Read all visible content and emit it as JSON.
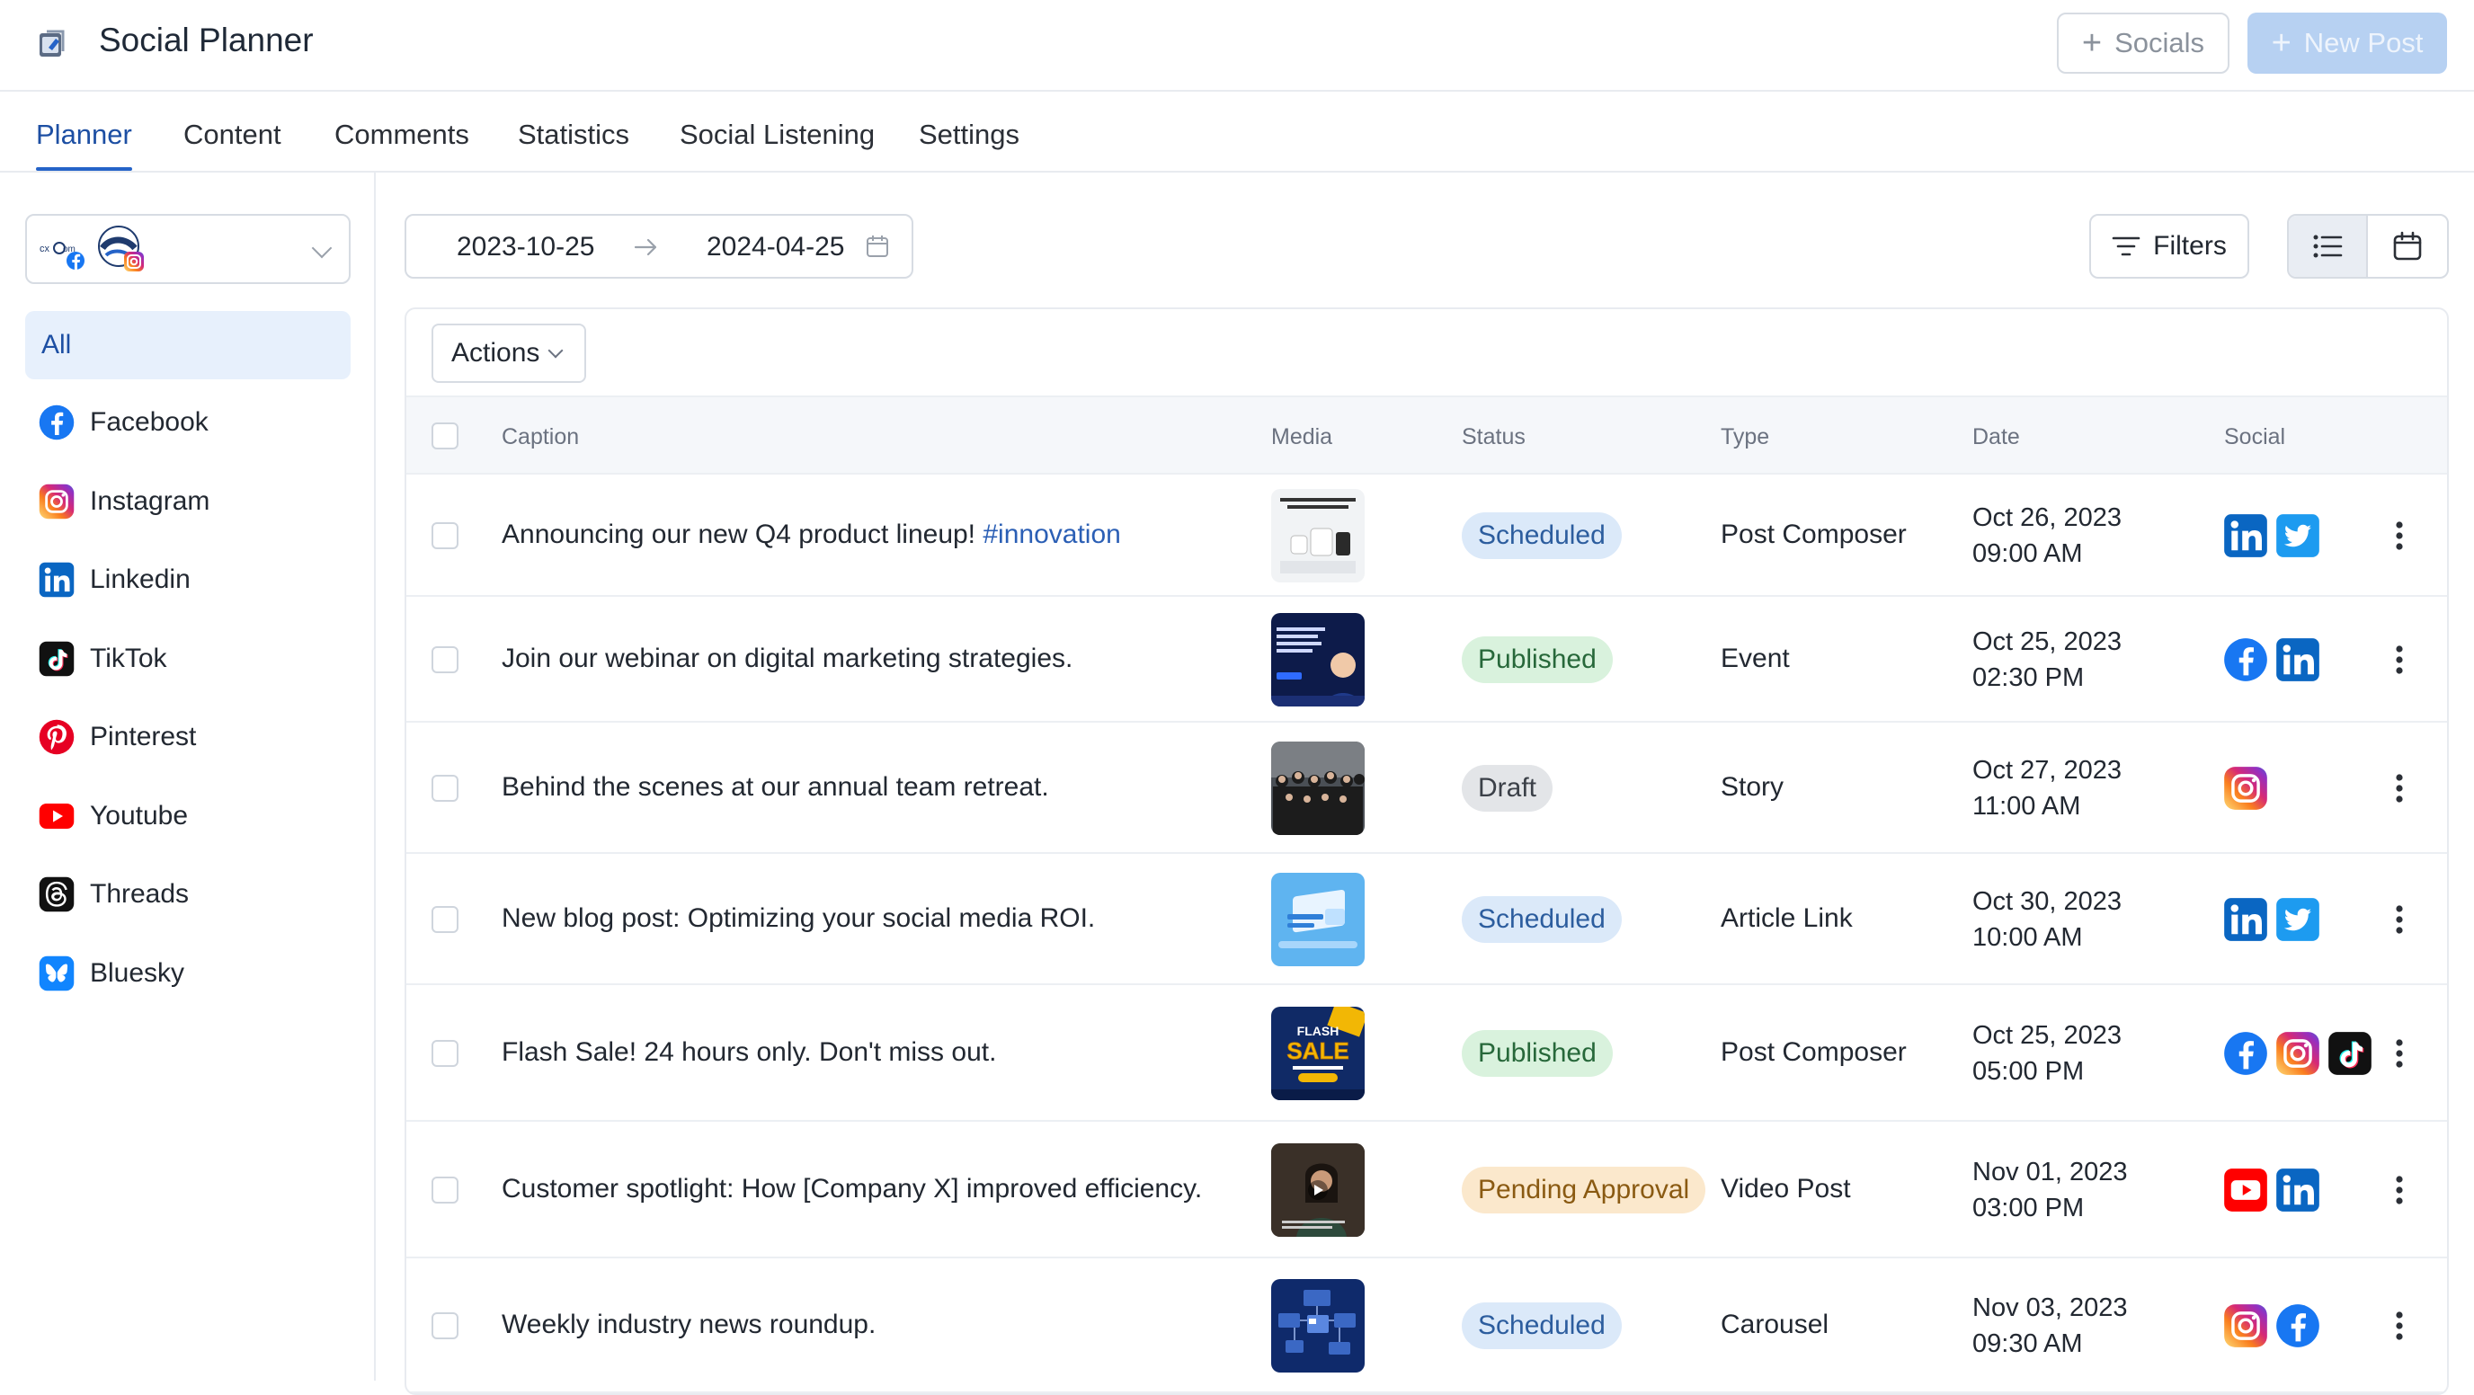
{
  "app": {
    "title": "Social Planner"
  },
  "header": {
    "socials_label": "Socials",
    "new_post_label": "New Post"
  },
  "tabs": [
    {
      "label": "Planner",
      "active": true
    },
    {
      "label": "Content"
    },
    {
      "label": "Comments"
    },
    {
      "label": "Statistics"
    },
    {
      "label": "Social Listening"
    },
    {
      "label": "Settings"
    }
  ],
  "sidebar": {
    "items": [
      {
        "label": "All",
        "active": true
      },
      {
        "label": "Facebook",
        "icon": "facebook-icon"
      },
      {
        "label": "Instagram",
        "icon": "instagram-icon"
      },
      {
        "label": "Linkedin",
        "icon": "linkedin-icon"
      },
      {
        "label": "TikTok",
        "icon": "tiktok-icon"
      },
      {
        "label": "Pinterest",
        "icon": "pinterest-icon"
      },
      {
        "label": "Youtube",
        "icon": "youtube-icon"
      },
      {
        "label": "Threads",
        "icon": "threads-icon"
      },
      {
        "label": "Bluesky",
        "icon": "bluesky-icon"
      }
    ]
  },
  "toolbar": {
    "date_start": "2023-10-25",
    "date_end": "2024-04-25",
    "filters_label": "Filters",
    "actions_label": "Actions"
  },
  "table": {
    "columns": [
      "Caption",
      "Media",
      "Status",
      "Type",
      "Date",
      "Social"
    ],
    "rows": [
      {
        "caption": "Announcing our new Q4 product lineup! ",
        "hashtag": "#innovation",
        "status": "Scheduled",
        "type": "Post Composer",
        "date": "Oct 26, 2023",
        "time": "09:00 AM",
        "socials": [
          "linkedin",
          "twitter"
        ]
      },
      {
        "caption": "Join our webinar on digital marketing strategies.",
        "hashtag": "",
        "status": "Published",
        "type": "Event",
        "date": "Oct 25, 2023",
        "time": "02:30 PM",
        "socials": [
          "facebook",
          "linkedin"
        ]
      },
      {
        "caption": "Behind the scenes at our annual team retreat.",
        "hashtag": "",
        "status": "Draft",
        "type": "Story",
        "date": "Oct 27, 2023",
        "time": "11:00 AM",
        "socials": [
          "instagram"
        ]
      },
      {
        "caption": "New blog post: Optimizing your social media ROI.",
        "hashtag": "",
        "status": "Scheduled",
        "type": "Article Link",
        "date": "Oct 30, 2023",
        "time": "10:00 AM",
        "socials": [
          "linkedin",
          "twitter"
        ]
      },
      {
        "caption": "Flash Sale! 24 hours only. Don't miss out.",
        "hashtag": "",
        "status": "Published",
        "type": "Post Composer",
        "date": "Oct 25, 2023",
        "time": "05:00 PM",
        "socials": [
          "facebook",
          "instagram",
          "tiktok"
        ],
        "media_text": [
          "FLASH",
          "SALE"
        ]
      },
      {
        "caption": "Customer spotlight: How [Company X] improved efficiency.",
        "hashtag": "",
        "status": "Pending Approval",
        "type": "Video Post",
        "date": "Nov 01, 2023",
        "time": "03:00 PM",
        "socials": [
          "youtube",
          "linkedin"
        ]
      },
      {
        "caption": "Weekly industry news roundup.",
        "hashtag": "",
        "status": "Scheduled",
        "type": "Carousel",
        "date": "Nov 03, 2023",
        "time": "09:30 AM",
        "socials": [
          "instagram",
          "facebook"
        ]
      }
    ]
  },
  "status_colors": {
    "Scheduled": {
      "bg": "#dbe9f9",
      "fg": "#2c5d9e"
    },
    "Published": {
      "bg": "#d9f2dd",
      "fg": "#27683a"
    },
    "Draft": {
      "bg": "#e3e5e8",
      "fg": "#3b4048"
    },
    "Pending Approval": {
      "bg": "#fbe8cc",
      "fg": "#8a5a12"
    }
  }
}
